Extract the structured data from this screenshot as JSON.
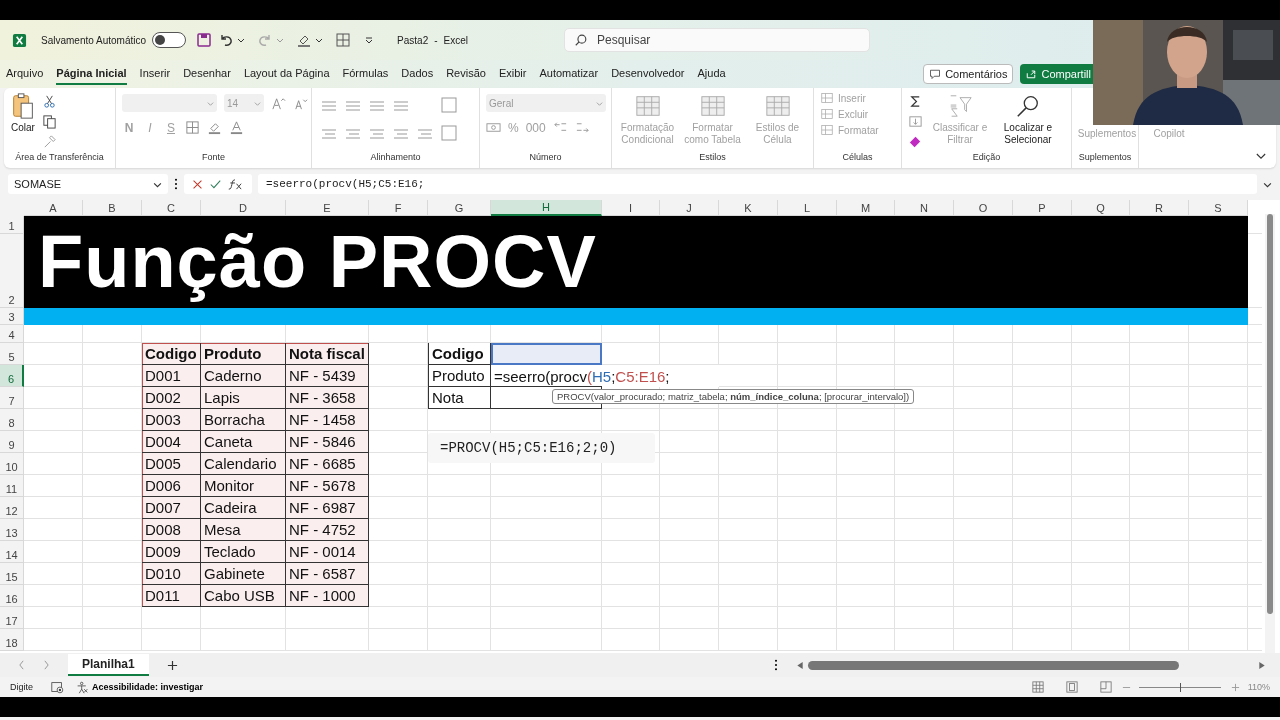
{
  "title_bar": {
    "autosave_label": "Salvamento Automático",
    "autosave_on": false,
    "document": "Pasta2",
    "separator": "-",
    "app": "Excel",
    "search_placeholder": "Pesquisar"
  },
  "menu_tabs": [
    {
      "label": "Arquivo",
      "selected": false
    },
    {
      "label": "Página Inicial",
      "selected": true
    },
    {
      "label": "Inserir",
      "selected": false
    },
    {
      "label": "Desenhar",
      "selected": false
    },
    {
      "label": "Layout da Página",
      "selected": false
    },
    {
      "label": "Fórmulas",
      "selected": false
    },
    {
      "label": "Dados",
      "selected": false
    },
    {
      "label": "Revisão",
      "selected": false
    },
    {
      "label": "Exibir",
      "selected": false
    },
    {
      "label": "Automatizar",
      "selected": false
    },
    {
      "label": "Desenvolvedor",
      "selected": false
    },
    {
      "label": "Ajuda",
      "selected": false
    }
  ],
  "comments_button": "Comentários",
  "share_button": "Compartill",
  "ribbon": [
    {
      "kind": "clipboard",
      "label": "Área de Transferência",
      "controls": [
        {
          "label": "Colar",
          "disabled": false
        }
      ]
    },
    {
      "kind": "font",
      "label": "Fonte",
      "font_size": "14",
      "controls": [
        {
          "label": "N",
          "disabled": true
        },
        {
          "label": "I",
          "disabled": true
        },
        {
          "label": "S",
          "disabled": true
        }
      ]
    },
    {
      "kind": "alignment",
      "label": "Alinhamento"
    },
    {
      "kind": "number",
      "label": "Número",
      "format": "Geral",
      "controls": [
        {
          "label": "%",
          "disabled": true
        },
        {
          "label": "000",
          "disabled": true
        }
      ]
    },
    {
      "kind": "styles",
      "label": "Estilos",
      "controls": [
        {
          "label": "Formatação Condicional",
          "disabled": true
        },
        {
          "label": "Formatar como Tabela",
          "disabled": true
        },
        {
          "label": "Estilos de Célula",
          "disabled": true
        }
      ]
    },
    {
      "kind": "cells",
      "label": "Células",
      "controls": [
        {
          "label": "Inserir",
          "disabled": true
        },
        {
          "label": "Excluir",
          "disabled": true
        },
        {
          "label": "Formatar",
          "disabled": true
        }
      ]
    },
    {
      "kind": "editing",
      "label": "Edição",
      "controls": [
        {
          "label": "Classificar e Filtrar",
          "disabled": true
        },
        {
          "label": "Localizar e Selecionar",
          "disabled": false
        }
      ]
    },
    {
      "kind": "addins",
      "label": "Suplementos",
      "controls": [
        {
          "label": "Suplementos",
          "disabled": true
        }
      ]
    },
    {
      "kind": "copilot",
      "controls": [
        {
          "label": "Copilot",
          "disabled": true
        }
      ]
    }
  ],
  "formula_bar": {
    "name_box": "SOMASE",
    "formula": "=seerro(procv(H5;C5:E16;"
  },
  "columns": [
    {
      "label": "A",
      "selected": false
    },
    {
      "label": "B",
      "selected": false
    },
    {
      "label": "C",
      "selected": false
    },
    {
      "label": "D",
      "selected": false
    },
    {
      "label": "E",
      "selected": false
    },
    {
      "label": "F",
      "selected": false
    },
    {
      "label": "G",
      "selected": false
    },
    {
      "label": "H",
      "selected": true
    },
    {
      "label": "I",
      "selected": false
    },
    {
      "label": "J",
      "selected": false
    },
    {
      "label": "K",
      "selected": false
    },
    {
      "label": "L",
      "selected": false
    },
    {
      "label": "M",
      "selected": false
    },
    {
      "label": "N",
      "selected": false
    },
    {
      "label": "O",
      "selected": false
    },
    {
      "label": "P",
      "selected": false
    },
    {
      "label": "Q",
      "selected": false
    },
    {
      "label": "R",
      "selected": false
    },
    {
      "label": "S",
      "selected": false
    }
  ],
  "rows": [
    {
      "label": "1",
      "selected": false
    },
    {
      "label": "2",
      "selected": false
    },
    {
      "label": "3",
      "selected": false
    },
    {
      "label": "4",
      "selected": false
    },
    {
      "label": "5",
      "selected": false
    },
    {
      "label": "6",
      "selected": true
    },
    {
      "label": "7",
      "selected": false
    },
    {
      "label": "8",
      "selected": false
    },
    {
      "label": "9",
      "selected": false
    },
    {
      "label": "10",
      "selected": false
    },
    {
      "label": "11",
      "selected": false
    },
    {
      "label": "12",
      "selected": false
    },
    {
      "label": "13",
      "selected": false
    },
    {
      "label": "14",
      "selected": false
    },
    {
      "label": "15",
      "selected": false
    },
    {
      "label": "16",
      "selected": false
    },
    {
      "label": "17",
      "selected": false
    },
    {
      "label": "18",
      "selected": false
    }
  ],
  "banner_title": "Função PROCV",
  "data_table": {
    "columns": [
      "Codigo",
      "Produto",
      "Nota fiscal"
    ],
    "rows": [
      [
        "D001",
        "Caderno",
        "NF - 5439"
      ],
      [
        "D002",
        "Lapis",
        "NF - 3658"
      ],
      [
        "D003",
        "Borracha",
        "NF - 1458"
      ],
      [
        "D004",
        "Caneta",
        "NF - 5846"
      ],
      [
        "D005",
        "Calendario",
        "NF - 6685"
      ],
      [
        "D006",
        "Monitor",
        "NF - 5678"
      ],
      [
        "D007",
        "Cadeira",
        "NF - 6987"
      ],
      [
        "D008",
        "Mesa",
        "NF - 4752"
      ],
      [
        "D009",
        "Teclado",
        "NF - 0014"
      ],
      [
        "D010",
        "Gabinete",
        "NF - 6587"
      ],
      [
        "D011",
        "Cabo USB",
        "NF - 1000"
      ]
    ]
  },
  "lookup_table": [
    {
      "label": "Codigo",
      "header": true,
      "selected": true
    },
    {
      "label": "Produto",
      "header": false,
      "selected": false,
      "value_segments": [
        {
          "text": "=seerro(procv"
        },
        {
          "text": "(",
          "color": "#c0504d"
        },
        {
          "text": "H5",
          "color": "#2e6db4"
        },
        {
          "text": ";"
        },
        {
          "text": "C5:E16",
          "color": "#c0504d"
        },
        {
          "text": ";"
        }
      ]
    },
    {
      "label": "Nota",
      "header": false,
      "selected": false
    }
  ],
  "tooltip": "PROCV(valor_procurado; matriz_tabela; **núm_índice_coluna**; [procurar_intervalo])",
  "text_box": "=PROCV(H5;C5:E16;2;0)",
  "sheet_tabs": [
    {
      "label": "Planilha1",
      "selected": true
    }
  ],
  "status_bar": {
    "mode": "Digite",
    "accessibility": "Acessibilidade: investigar",
    "zoom": "110%",
    "zoom_slider": {
      "level": 0.5
    }
  }
}
